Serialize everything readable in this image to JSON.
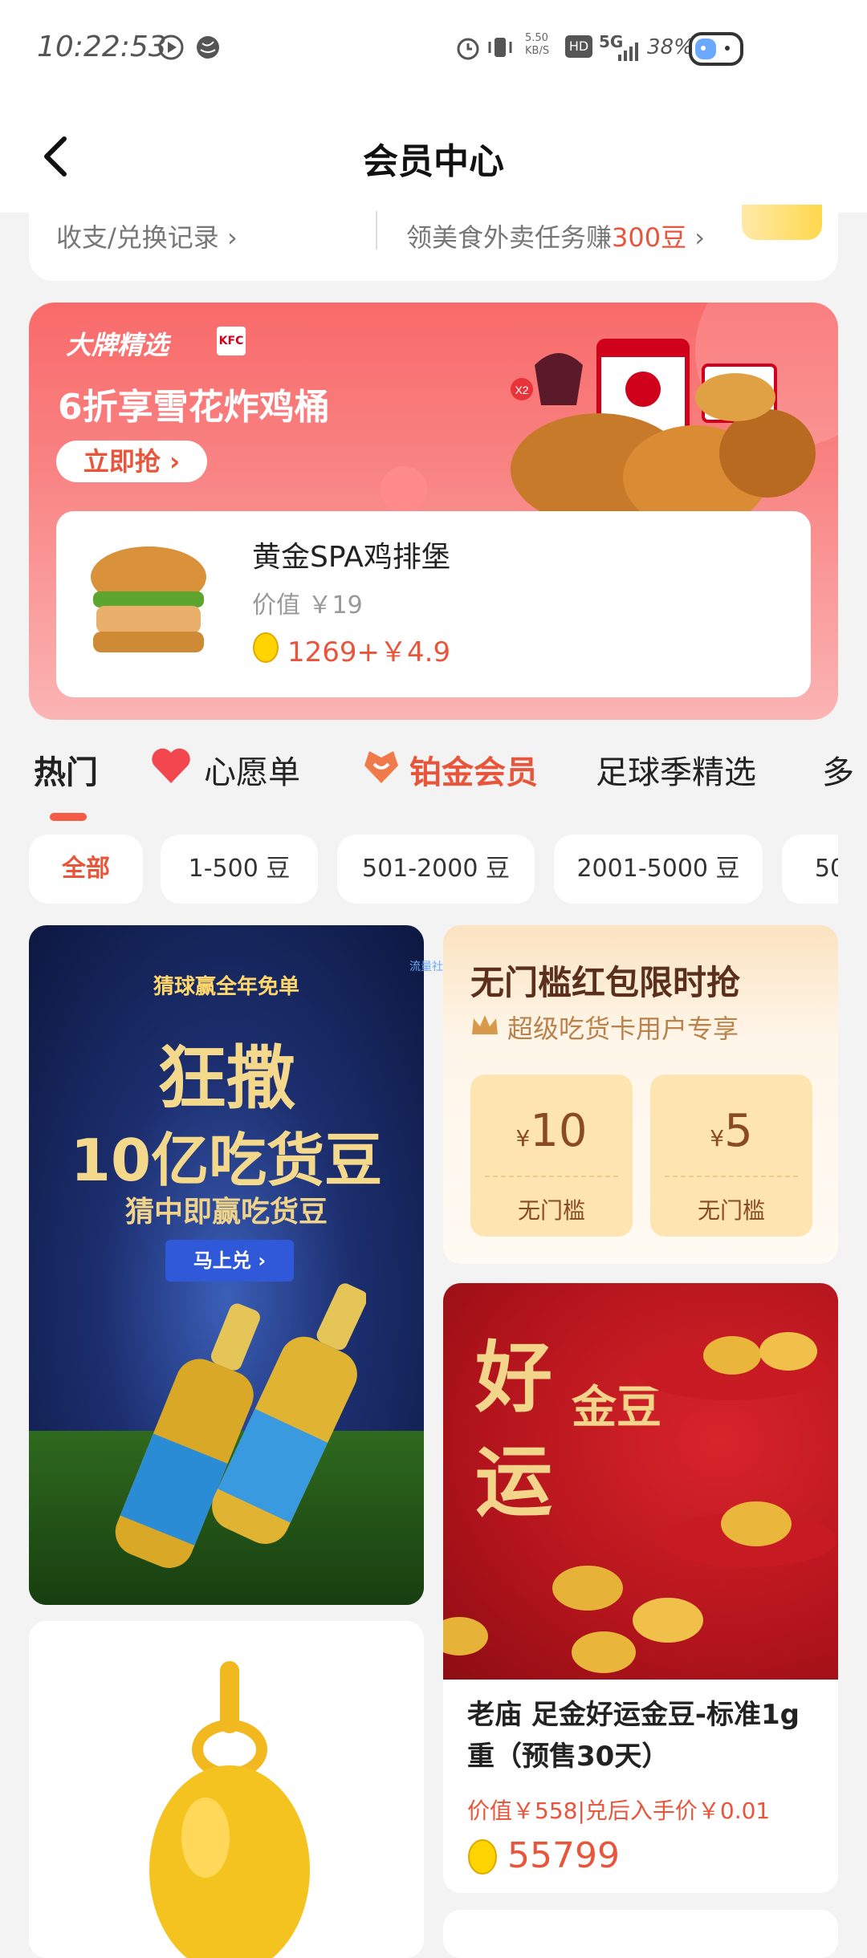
{
  "status_bar": {
    "time": "10:22:53",
    "network_speed": "5.50",
    "network_unit": "KB/S",
    "hd": "HD",
    "signal": "5G",
    "battery": "38%"
  },
  "header": {
    "title": "会员中心"
  },
  "records": {
    "left_text": "收支/兑换记录 ›",
    "right_prefix": "领美食外卖任务赚",
    "right_highlight": "300豆",
    "right_suffix": " ›"
  },
  "promo": {
    "brand": "大牌精选",
    "kfc": "KFC",
    "headline": "6折享雪花炸鸡桶",
    "grab_label": "立即抢 ›",
    "x2": "X2",
    "product": {
      "name": "黄金SPA鸡排堡",
      "value": "价值 ￥19",
      "price": "1269+￥4.9"
    }
  },
  "tabs": [
    {
      "label": "热门"
    },
    {
      "label": "心愿单"
    },
    {
      "label": "铂金会员"
    },
    {
      "label": "足球季精选"
    },
    {
      "label": "多"
    }
  ],
  "chips": [
    {
      "label": "全部"
    },
    {
      "label": "1-500 豆"
    },
    {
      "label": "501-2000 豆"
    },
    {
      "label": "2001-5000 豆"
    },
    {
      "label": "50"
    }
  ],
  "card_beer": {
    "ribbon": "猜球赢全年免单",
    "line1": "狂撒",
    "line2": "10亿吃货豆",
    "line3": "猜中即赢吃货豆",
    "cta": "马上兑 ›",
    "watermark": "流量社区"
  },
  "card_coupon": {
    "title": "无门槛红包限时抢",
    "subtitle": "超级吃货卡用户专享",
    "coupons": [
      {
        "symbol": "¥",
        "amount": "10",
        "label": "无门槛"
      },
      {
        "symbol": "¥",
        "amount": "5",
        "label": "无门槛"
      }
    ]
  },
  "card_gold": {
    "calli_1": "好",
    "calli_2": "运",
    "calli_3": "金豆",
    "name": "老庙 足金好运金豆-标准1g重（预售30天）",
    "value": "价值￥558|兑后入手价￥0.01",
    "beans": "55799"
  },
  "colors": {
    "accent": "#e8553a",
    "coin": "#ffd400",
    "promo_bg": "#f96a6a"
  }
}
